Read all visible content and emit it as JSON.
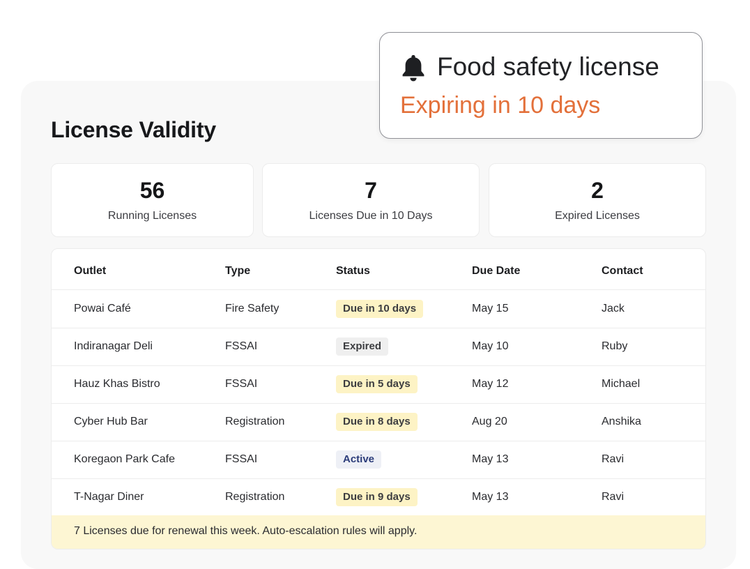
{
  "page_title": "License Validity",
  "notification": {
    "icon": "bell-icon",
    "title": "Food safety license",
    "subtitle": "Expiring in 10 days",
    "subtitle_color": "#e3703a"
  },
  "stats": [
    {
      "value": "56",
      "label": "Running Licenses"
    },
    {
      "value": "7",
      "label": "Licenses Due in 10 Days"
    },
    {
      "value": "2",
      "label": "Expired Licenses"
    }
  ],
  "table": {
    "columns": [
      "Outlet",
      "Type",
      "Status",
      "Due Date",
      "Contact"
    ],
    "rows": [
      {
        "outlet": "Powai Café",
        "type": "Fire Safety",
        "status": "Due in 10 days",
        "status_kind": "due",
        "due_date": "May 15",
        "contact": "Jack"
      },
      {
        "outlet": "Indiranagar Deli",
        "type": "FSSAI",
        "status": "Expired",
        "status_kind": "expired",
        "due_date": "May 10",
        "contact": "Ruby"
      },
      {
        "outlet": "Hauz Khas Bistro",
        "type": "FSSAI",
        "status": "Due in 5 days",
        "status_kind": "due",
        "due_date": "May 12",
        "contact": "Michael"
      },
      {
        "outlet": "Cyber Hub Bar",
        "type": "Registration",
        "status": "Due in 8 days",
        "status_kind": "due",
        "due_date": "Aug 20",
        "contact": "Anshika"
      },
      {
        "outlet": "Koregaon Park Cafe",
        "type": "FSSAI",
        "status": "Active",
        "status_kind": "active",
        "due_date": "May 13",
        "contact": "Ravi"
      },
      {
        "outlet": "T-Nagar Diner",
        "type": "Registration",
        "status": "Due in 9 days",
        "status_kind": "due",
        "due_date": "May 13",
        "contact": "Ravi"
      }
    ],
    "footer_note": "7 Licenses due for renewal this week. Auto-escalation rules will apply."
  },
  "colors": {
    "due_badge_bg": "#fdf3c5",
    "expired_badge_bg": "#efefef",
    "active_badge_bg": "#eef0f6",
    "active_badge_text": "#2c3d7a",
    "footer_bg": "#fdf6d3"
  }
}
